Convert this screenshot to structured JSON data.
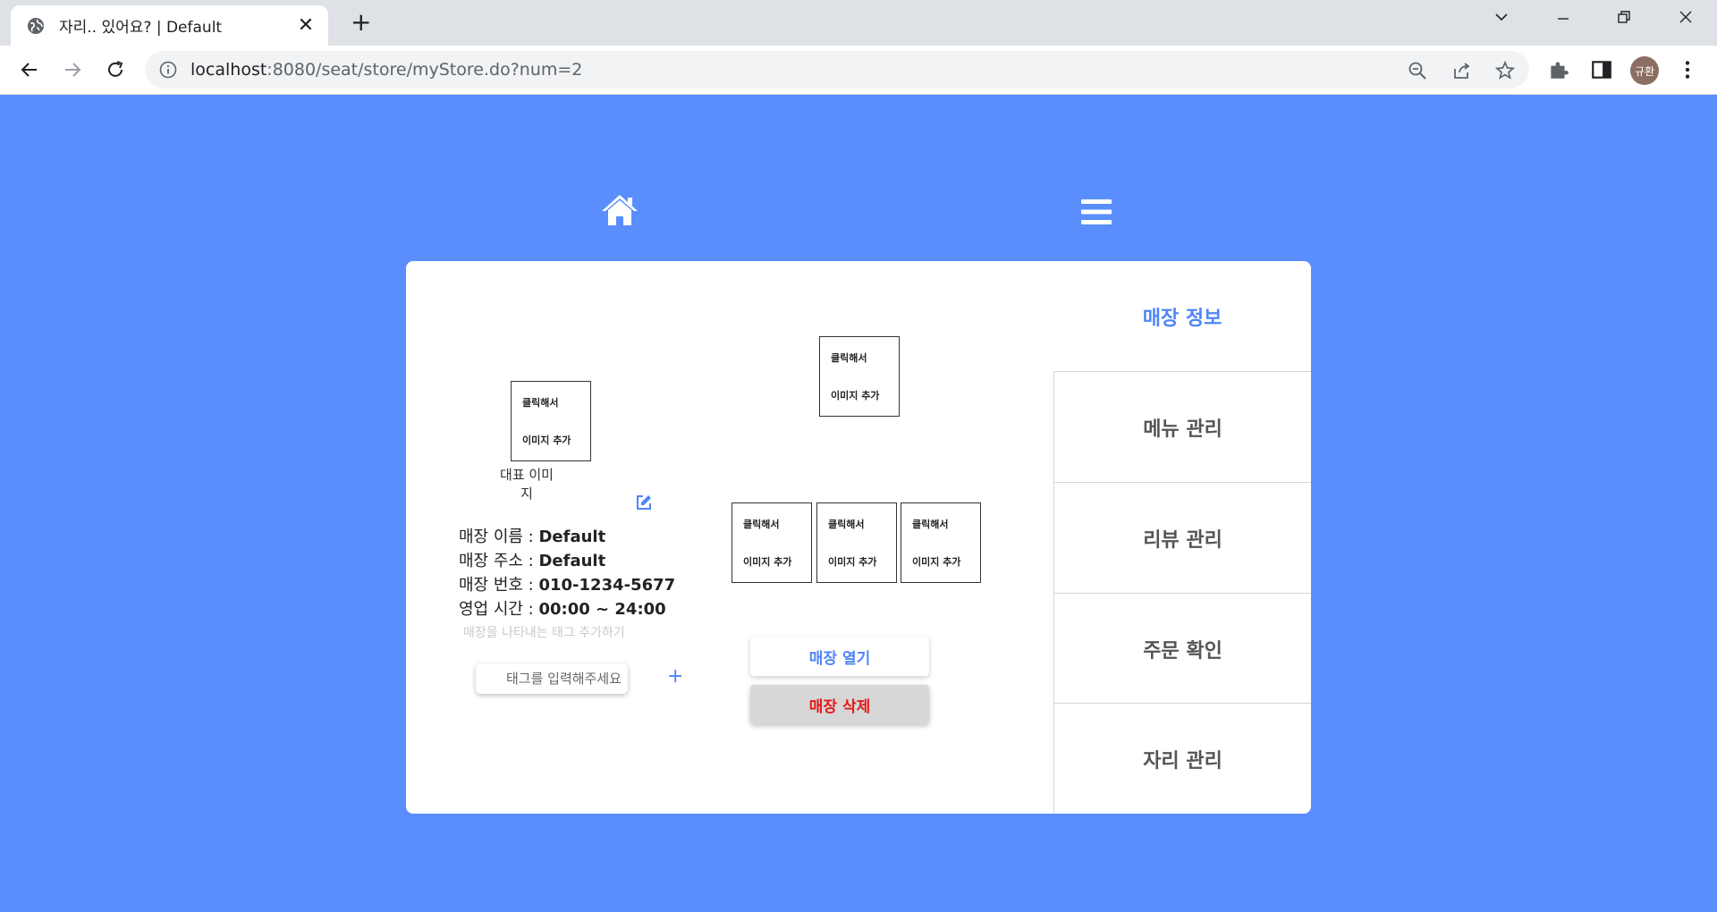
{
  "browser": {
    "tab_title": "자리.. 있어요? | Default",
    "url_host": "localhost",
    "url_rest": ":8080/seat/store/myStore.do?num=2",
    "profile_initials": "규환"
  },
  "nav": {
    "home_icon": "home-icon",
    "menu_icon": "hamburger-menu-icon"
  },
  "images": {
    "click_line1": "클릭해서",
    "click_line2": "이미지 추가",
    "representative_caption": "대표 이미지"
  },
  "store": {
    "name_label": "매장 이름 : ",
    "name_value": "Default",
    "address_label": "매장 주소 : ",
    "address_value": "Default",
    "phone_label": "매장 번호 : ",
    "phone_value": "010-1234-5677",
    "hours_label": "영업 시간 : ",
    "hours_value": "00:00 ~ 24:00"
  },
  "tags": {
    "hint": "매장을 나타내는 태그 추가하기",
    "placeholder": "태그를 입력해주세요",
    "add_symbol": "+"
  },
  "actions": {
    "open": "매장 열기",
    "delete": "매장 삭제"
  },
  "side_menu": {
    "items": [
      {
        "label": "매장 정보",
        "active": true
      },
      {
        "label": "메뉴 관리",
        "active": false
      },
      {
        "label": "리뷰 관리",
        "active": false
      },
      {
        "label": "주문 확인",
        "active": false
      },
      {
        "label": "자리 관리",
        "active": false
      }
    ]
  },
  "colors": {
    "background": "#5a8efd",
    "accent": "#4f86f7",
    "danger": "#e51818"
  }
}
